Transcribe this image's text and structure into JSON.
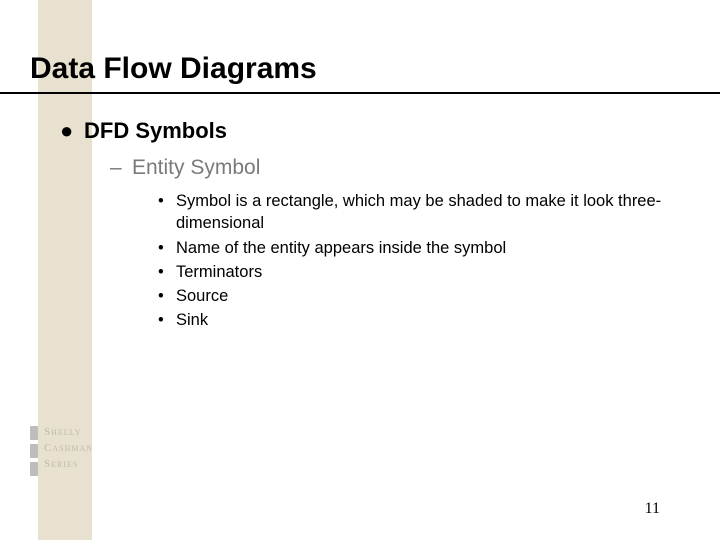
{
  "title": "Data Flow Diagrams",
  "level1": {
    "marker": "●",
    "text": "DFD Symbols"
  },
  "level2": {
    "marker": "–",
    "text": "Entity Symbol"
  },
  "level3_marker": "•",
  "level3": {
    "i0": "Symbol is a rectangle, which may be shaded to make it look three-dimensional",
    "i1": "Name of the entity appears inside the symbol",
    "i2": "Terminators",
    "i3": "Source",
    "i4": "Sink"
  },
  "page_number": "11",
  "logo": {
    "line1": "Shelly",
    "line2": "Cashman",
    "line3": "Series"
  }
}
